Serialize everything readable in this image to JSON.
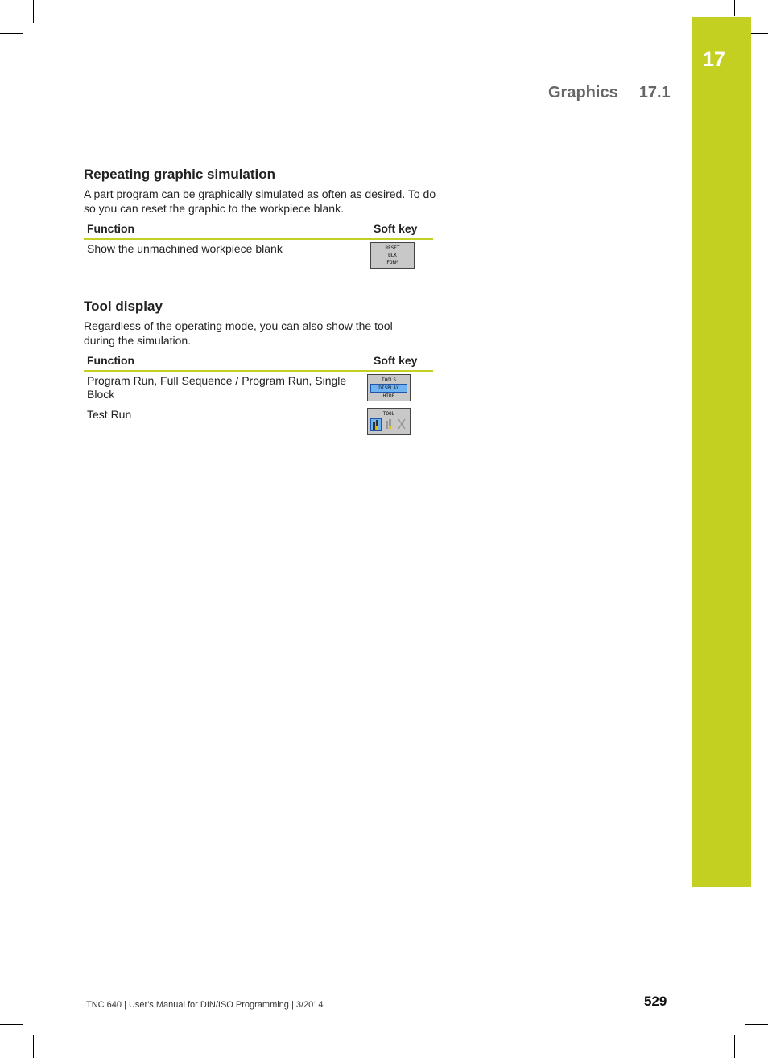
{
  "header": {
    "chapter_title": "Graphics",
    "section_number": "17.1"
  },
  "chapter_tab": {
    "number": "17",
    "color": "#c3cf21"
  },
  "sections": [
    {
      "heading": "Repeating graphic simulation",
      "body": "A part program can be graphically simulated as often as desired. To do so you can reset the graphic to the workpiece blank.",
      "table": {
        "headers": [
          "Function",
          "Soft key"
        ],
        "rows": [
          {
            "function": "Show the unmachined workpiece blank",
            "softkey": {
              "icon": "reset-blk-form-softkey",
              "lines": [
                "RESET",
                "BLK",
                "FORM"
              ]
            }
          }
        ]
      }
    },
    {
      "heading": "Tool display",
      "body": "Regardless of the operating mode, you can also show the tool during the simulation.",
      "table": {
        "headers": [
          "Function",
          "Soft key"
        ],
        "rows": [
          {
            "function": "Program Run, Full Sequence / Program Run, Single Block",
            "softkey": {
              "icon": "tools-display-hide-softkey",
              "lines": [
                "TOOLS",
                "DISPLAY",
                "HIDE"
              ],
              "highlighted": "DISPLAY"
            }
          },
          {
            "function": "Test Run",
            "softkey": {
              "icon": "tool-view-softkey",
              "lines": [
                "TOOL"
              ]
            }
          }
        ]
      }
    }
  ],
  "footer": {
    "text": "TNC 640 | User's Manual for DIN/ISO Programming | 3/2014",
    "page_number": "529"
  }
}
